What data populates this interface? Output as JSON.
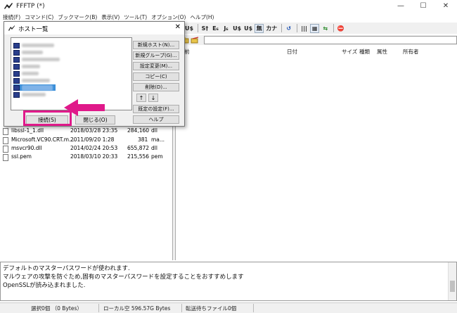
{
  "app": {
    "title": "FFFTP (*)",
    "min_glyph": "—",
    "max_glyph": "☐",
    "close_glyph": "✕"
  },
  "menu": [
    "接続(F)",
    "コマンド(C)",
    "ブックマーク(B)",
    "表示(V)",
    "ツール(T)",
    "オプション(O)",
    "ヘルプ(H)"
  ],
  "toolbar": {
    "buttons": [
      "U$",
      "S†",
      "E₆",
      "J₆",
      "U$",
      "U$",
      "無",
      "カナ",
      "↺",
      "|||",
      "▦",
      "⇆",
      "⛔"
    ]
  },
  "right_pane": {
    "columns": [
      "名前",
      "日付",
      "サイズ",
      "種類",
      "属性",
      "所有者"
    ],
    "name_col_visible": "前"
  },
  "left_files": [
    {
      "name": "libssl-1_1.dll",
      "date": "2018/03/28 23:35",
      "size": "284,160",
      "type": "dll"
    },
    {
      "name": "Microsoft.VC90.CRT.m...",
      "date": "2011/09/20 1:28",
      "size": "381",
      "type": "ma..."
    },
    {
      "name": "msvcr90.dll",
      "date": "2014/02/24 20:53",
      "size": "655,872",
      "type": "dll"
    },
    {
      "name": "ssl.pem",
      "date": "2018/03/10 20:33",
      "size": "215,556",
      "type": "pem"
    }
  ],
  "dialog": {
    "title": "ホスト一覧",
    "close_glyph": "✕",
    "hosts": [
      "host-1",
      "host-2",
      "host-3",
      "host-4",
      "host-5",
      "host-6",
      "host-7",
      "host-8"
    ],
    "selected_index": 6,
    "side_buttons": [
      "新規ホスト(N)...",
      "新規グループ(G)...",
      "設定変更(M)...",
      "コピー(C)",
      "削除(D)..."
    ],
    "up_arrow": "↑",
    "down_arrow": "↓",
    "default_settings": "既定の設定(F)...",
    "help": "ヘルプ",
    "connect": "接続(S)",
    "close": "閉じる(O)"
  },
  "log": [
    "デフォルトのマスターパスワードが使われます.",
    "マルウェアの攻撃を防ぐため,固有のマスターパスワードを設定することをおすすめします",
    "OpenSSLが読み込まれました."
  ],
  "status": {
    "selected": "選択0個 （0 Bytes）",
    "local_free": "ローカル空 596.57G Bytes",
    "queue": "転送待ちファイル0個"
  },
  "colors": {
    "highlight": "#e0198a",
    "selection": "#3b8fd9"
  }
}
